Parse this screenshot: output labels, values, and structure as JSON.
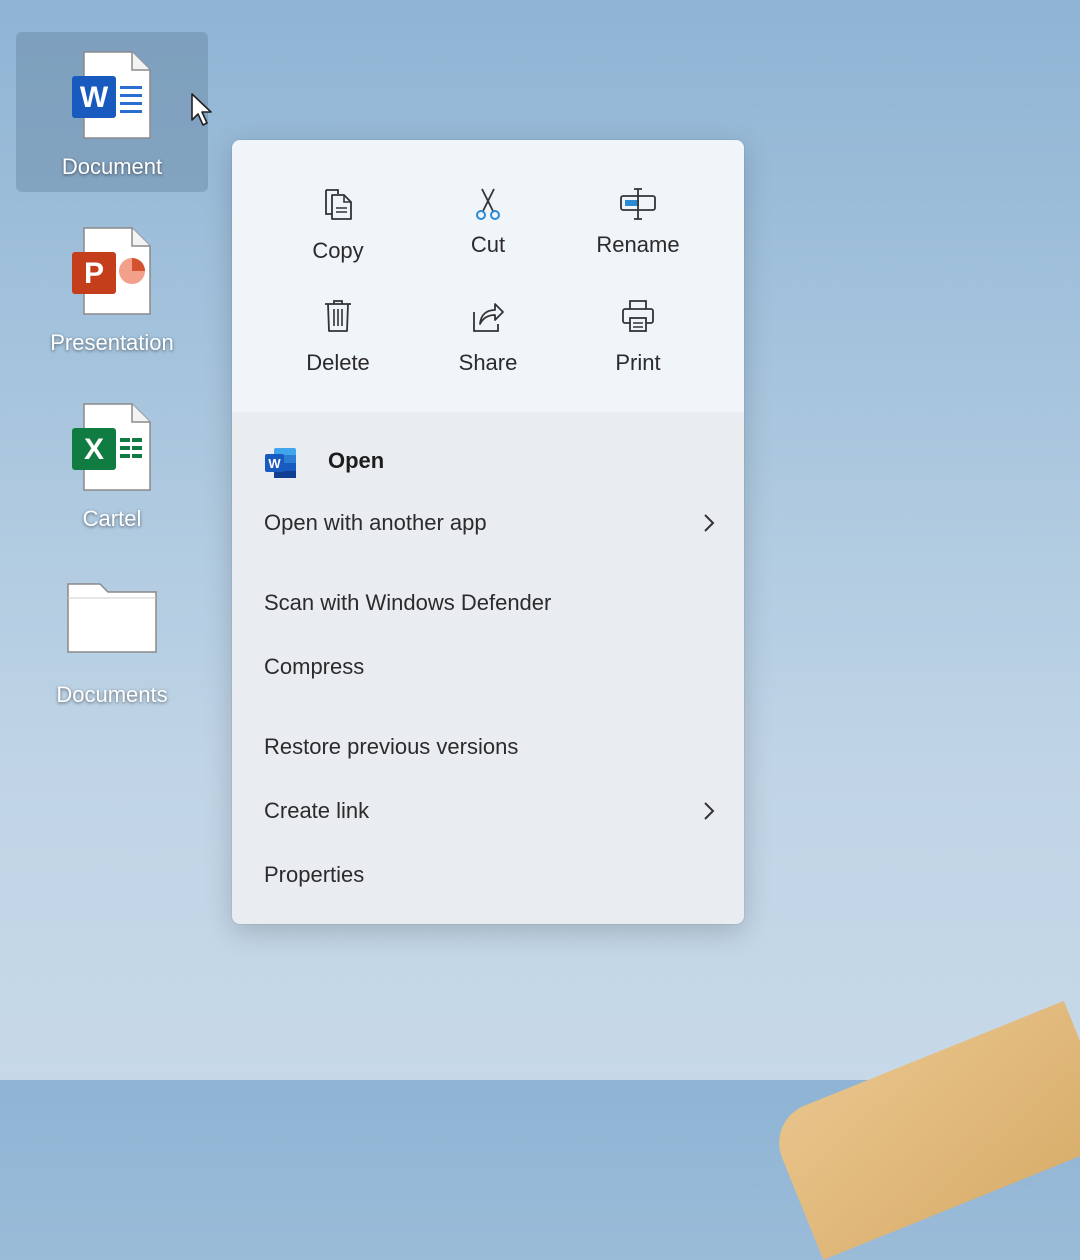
{
  "desktop": {
    "icons": [
      {
        "label": "Document",
        "type": "word",
        "selected": true
      },
      {
        "label": "Presentation",
        "type": "powerpoint",
        "selected": false
      },
      {
        "label": "Cartel",
        "type": "excel",
        "selected": false
      },
      {
        "label": "Documents",
        "type": "folder",
        "selected": false
      }
    ]
  },
  "context_menu": {
    "quick_actions": [
      {
        "label": "Copy",
        "icon": "copy-icon"
      },
      {
        "label": "Cut",
        "icon": "scissors-icon"
      },
      {
        "label": "Rename",
        "icon": "rename-icon"
      },
      {
        "label": "Delete",
        "icon": "trash-icon"
      },
      {
        "label": "Share",
        "icon": "share-icon"
      },
      {
        "label": "Print",
        "icon": "printer-icon"
      }
    ],
    "items": [
      {
        "label": "Open",
        "icon": "word-app-icon",
        "bold": true
      },
      {
        "label": "Open with another app",
        "submenu": true
      },
      {
        "label": "Scan with Windows Defender"
      },
      {
        "label": "Compress"
      },
      {
        "label": "Restore previous versions"
      },
      {
        "label": "Create link",
        "submenu": true
      },
      {
        "label": "Properties"
      }
    ]
  },
  "colors": {
    "word_blue": "#185abd",
    "powerpoint_orange": "#c43e1c",
    "excel_green": "#107c41",
    "accent_blue": "#2a8ad4"
  }
}
